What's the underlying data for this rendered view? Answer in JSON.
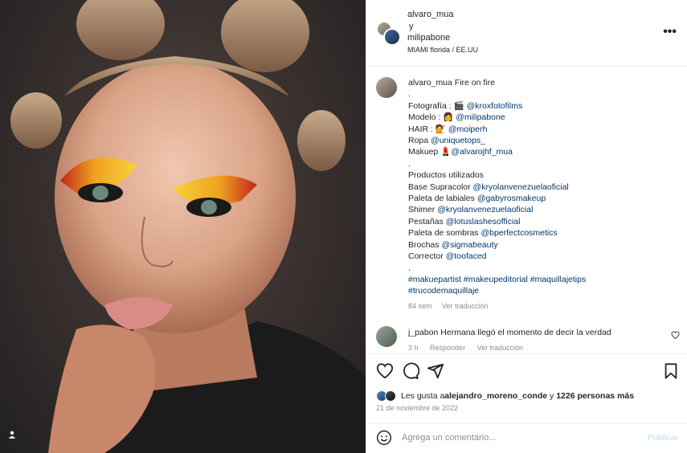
{
  "header": {
    "user1": "alvaro_mua",
    "connector": "y",
    "user2": "milipabone",
    "location": "MIAMI florida / EE.UU",
    "more_icon": "more-horizontal-icon"
  },
  "caption": {
    "username": "alvaro_mua",
    "title": "Fire on fire",
    "dot1": ".",
    "credits": [
      {
        "label": "Fotografía : 🎬 ",
        "handle": "@kroxfotofilms"
      },
      {
        "label": "Modelo : 👩 ",
        "handle": "@milipabone"
      },
      {
        "label": "HAIR : 💇 ",
        "handle": "@moiperh"
      },
      {
        "label": "Ropa ",
        "handle": "@uniquetops_"
      },
      {
        "label": "Makuep 💄",
        "handle": "@alvarojhf_mua"
      }
    ],
    "dot2": ".",
    "products_title": "Productos utilizados",
    "products": [
      {
        "label": "Base Supracolor ",
        "handle": "@kryolanvenezuelaoficial"
      },
      {
        "label": "Paleta de labiales ",
        "handle": "@gabyrosmakeup"
      },
      {
        "label": "Shimer ",
        "handle": "@kryolanvenezuelaoficial"
      },
      {
        "label": "Pestañas ",
        "handle": "@lotuslashesofficial"
      },
      {
        "label": "Paleta de sombras ",
        "handle": "@bperfectcosmetics"
      },
      {
        "label": "Brochas ",
        "handle": "@sigmabeauty"
      },
      {
        "label": "Corrector ",
        "handle": "@toofaced"
      }
    ],
    "dot3": ".",
    "hashtags_line1": "#makuepartist #makeupeditorial #maquillajetips",
    "hashtags_line2": "#trucodemaquillaje",
    "time": "84 sem",
    "translate": "Ver traducción"
  },
  "comment": {
    "username": "j_pabon",
    "text": "Hermana llegó el momento de decir la verdad",
    "time": "3 h",
    "reply": "Responder",
    "translate": "Ver traducción"
  },
  "actions": {
    "likes_prefix": "Les gusta a ",
    "likes_user": "alejandro_moreno_conde",
    "likes_middle": " y ",
    "likes_count": "1226 personas más",
    "date": "21 de noviembre de 2022"
  },
  "add_comment": {
    "placeholder": "Agrega un comentario...",
    "publish": "Publicar"
  },
  "colors": {
    "link": "#00376b",
    "muted": "#8e8e8e",
    "publish_disabled": "#b2dffc"
  }
}
